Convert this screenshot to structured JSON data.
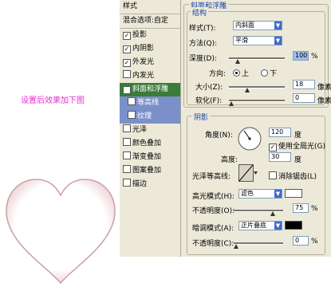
{
  "caption": "设置后效果加下图",
  "style_panel": {
    "title": "样式",
    "blending_options": "混合选项:自定",
    "items": [
      {
        "label": "投影",
        "checked": true
      },
      {
        "label": "内阴影",
        "checked": true
      },
      {
        "label": "外发光",
        "checked": true
      },
      {
        "label": "内发光",
        "checked": false
      },
      {
        "label": "斜面和浮雕",
        "checked": true,
        "selected": true
      },
      {
        "label": "等高线",
        "checked": false,
        "sub": true
      },
      {
        "label": "纹理",
        "checked": false,
        "sub": true
      },
      {
        "label": "光泽",
        "checked": false
      },
      {
        "label": "颜色叠加",
        "checked": false
      },
      {
        "label": "渐变叠加",
        "checked": false
      },
      {
        "label": "图案叠加",
        "checked": false
      },
      {
        "label": "描边",
        "checked": false
      }
    ]
  },
  "bevel": {
    "title": "斜面和浮雕",
    "structure": {
      "title": "结构",
      "style_label": "样式(T):",
      "style_value": "内斜面",
      "technique_label": "方法(Q):",
      "technique_value": "平滑",
      "depth_label": "深度(D):",
      "depth_value": "100",
      "depth_unit": "%",
      "direction_label": "方向:",
      "direction_up": "上",
      "direction_down": "下",
      "size_label": "大小(Z):",
      "size_value": "18",
      "size_unit": "像素",
      "soften_label": "软化(F):",
      "soften_value": "0",
      "soften_unit": "像素"
    },
    "shading": {
      "title": "阴影",
      "angle_label": "角度(N):",
      "angle_value": "120",
      "angle_unit": "度",
      "global_light_label": "使用全局光(G)",
      "altitude_label": "高度:",
      "altitude_value": "30",
      "altitude_unit": "度",
      "gloss_contour_label": "光泽等高线:",
      "antialiased_label": "消除锯齿(L)",
      "highlight_mode_label": "高光模式(H):",
      "highlight_mode_value": "滤色",
      "highlight_opacity_label": "不透明度(O):",
      "highlight_opacity_value": "75",
      "highlight_opacity_unit": "%",
      "shadow_mode_label": "暗调模式(A):",
      "shadow_mode_value": "正片叠底",
      "shadow_opacity_label": "不透明度(C):",
      "shadow_opacity_value": "0",
      "shadow_opacity_unit": "%"
    }
  },
  "colors": {
    "accent": "#3a7c3a",
    "sub_highlight": "#7b8fc9",
    "caption": "#ec2bd2",
    "panel": "#ece9d8",
    "highlight_color": "#ffffff",
    "shadow_color": "#000000"
  }
}
